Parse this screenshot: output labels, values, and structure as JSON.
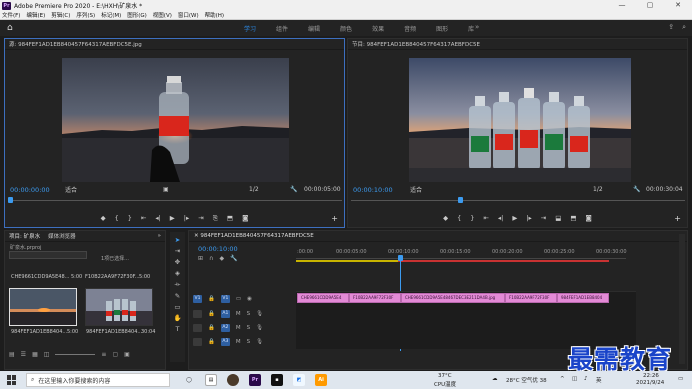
{
  "titlebar": {
    "logo": "Pr",
    "title": "Adobe Premiere Pro 2020 - E:\\HXH\\矿泉水 *",
    "min": "—",
    "max": "▢",
    "close": "✕"
  },
  "menu": [
    "文件(F)",
    "编辑(E)",
    "剪辑(C)",
    "序列(S)",
    "标记(M)",
    "图形(G)",
    "视图(V)",
    "窗口(W)",
    "帮助(H)"
  ],
  "workspace": {
    "tabs": [
      "学习",
      "组件",
      "编辑",
      "颜色",
      "效果",
      "音频",
      "图形",
      "库"
    ],
    "active_tab": "学习",
    "more": "»"
  },
  "source_monitor": {
    "header": "源: 984FEF1AD1EB840457F64317AEBFDC5E.jpg",
    "timecode_in": "00:00:00:00",
    "fit": "适合",
    "page": "1/2",
    "duration": "00:00:05:00"
  },
  "program_monitor": {
    "header": "节目: 984FEF1AD1EB840457F64317AEBFDC5E",
    "timecode_in": "00:00:10:00",
    "fit": "适合",
    "page": "1/2",
    "duration": "00:00:30:04"
  },
  "project": {
    "tabs": [
      "项目: 矿泉水",
      "媒体浏览器"
    ],
    "more": "»",
    "file": "矿泉水.prproj",
    "selected_info": "1项已选择...",
    "row_items": [
      {
        "name": "CHE9661CDD9A5E48...",
        "dur": "5:00"
      },
      {
        "name": "F10B22AA9F72F30F...",
        "dur": "5:00"
      }
    ],
    "thumbs": [
      {
        "name": "984FEF1AD1EB8404...",
        "dur": "5:00"
      },
      {
        "name": "984FEF1AD1EB8404...",
        "dur": "30:04"
      }
    ]
  },
  "timeline": {
    "header": "984FEF1AD1EB840457F64317AEBFDC5E",
    "timecode": "00:00:10:00",
    "ruler": [
      ":00:00",
      "00:00:05:00",
      "00:00:10:00",
      "00:00:15:00",
      "00:00:20:00",
      "00:00:25:00",
      "00:00:30:00"
    ],
    "tracks": [
      {
        "src": "V1",
        "name": "V1"
      },
      {
        "src": "",
        "name": "A1"
      },
      {
        "src": "",
        "name": "A2"
      },
      {
        "src": "",
        "name": "A3"
      }
    ],
    "clips": [
      "CHE9661CDD9A5E4",
      "F10B22AA9F72F30F",
      "CHE9661CDD9A5E48467DEC3E211DA4B.jpg",
      "F10B22AA9F72F30F",
      "984FEF1AD1EB8404"
    ]
  },
  "taskbar": {
    "search_placeholder": "在这里输入你要搜索的内容",
    "weather": "28°C 空气优 38",
    "cpu_temp": "37°C",
    "cpu_label": "CPU温度",
    "time": "22:26",
    "date": "2021/9/24",
    "lang": "英",
    "ai_badge": "Ai"
  },
  "watermark": "最需教育",
  "colors": {
    "accent": "#3c9bf0",
    "clip": "#e38ad6",
    "panel_active": "#3d6fbf"
  }
}
